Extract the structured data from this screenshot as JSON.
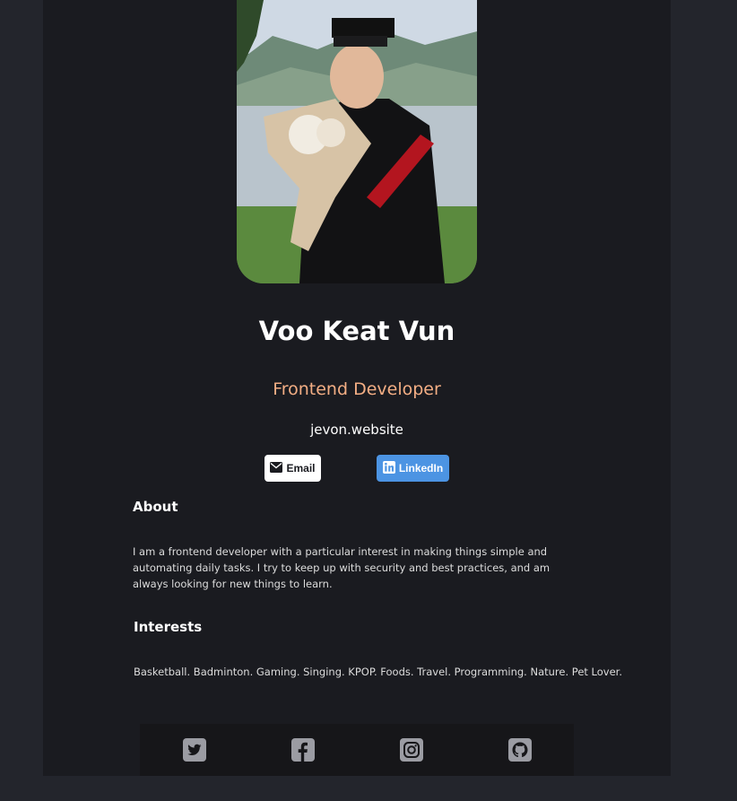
{
  "profile": {
    "name": "Voo Keat Vun",
    "role": "Frontend Developer",
    "website": "jevon.website"
  },
  "buttons": {
    "email_label": "Email",
    "linkedin_label": "LinkedIn"
  },
  "about": {
    "title": "About",
    "text": "I am a frontend developer with a particular interest in making things simple and automating daily tasks. I try to keep up with security and best practices, and am always looking for new things to learn."
  },
  "interests": {
    "title": "Interests",
    "text": "Basketball. Badminton. Gaming. Singing. KPOP. Foods. Travel. Programming. Nature. Pet Lover."
  },
  "footer": {
    "icons": [
      "twitter-icon",
      "facebook-icon",
      "instagram-icon",
      "github-icon"
    ]
  },
  "colors": {
    "background": "#23252c",
    "card": "#1a1b20",
    "accent": "#f3ae84",
    "linkedin": "#4c94e3",
    "footer": "#161619",
    "icon": "#9b9ca3"
  }
}
